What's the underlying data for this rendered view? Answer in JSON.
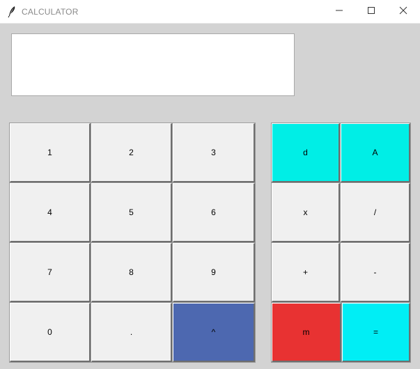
{
  "window": {
    "title": "CALCULATOR",
    "controls": [
      "minimize-icon",
      "maximize-icon",
      "close-icon"
    ]
  },
  "display": {
    "value": ""
  },
  "keypad": {
    "k1": "1",
    "k2": "2",
    "k3": "3",
    "k4": "4",
    "k5": "5",
    "k6": "6",
    "k7": "7",
    "k8": "8",
    "k9": "9",
    "k0": "0",
    "dot": ".",
    "pow": "^"
  },
  "ops": {
    "d": "d",
    "A": "A",
    "mul": "x",
    "div": "/",
    "add": "+",
    "sub": "-",
    "m": "m",
    "eq": "="
  },
  "colors": {
    "cyan": "#00eee6",
    "blue": "#4d68b0",
    "red": "#e83232",
    "default_key": "#f0f0f0"
  }
}
